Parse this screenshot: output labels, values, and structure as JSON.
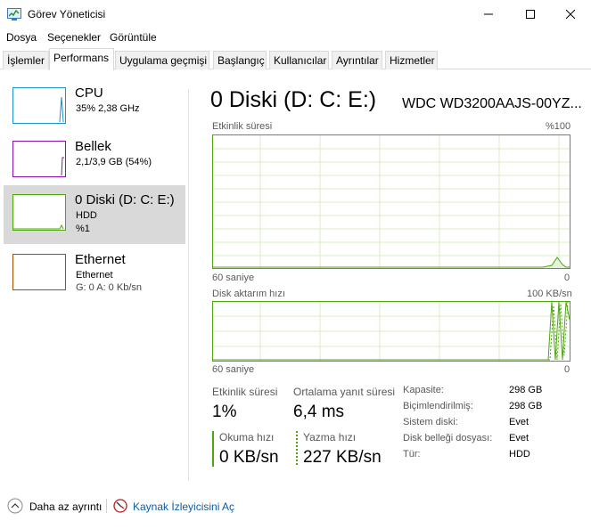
{
  "window": {
    "title": "Görev Yöneticisi"
  },
  "menu": [
    "Dosya",
    "Seçenekler",
    "Görüntüle"
  ],
  "tabs": [
    "İşlemler",
    "Performans",
    "Uygulama geçmişi",
    "Başlangıç",
    "Kullanıcılar",
    "Ayrıntılar",
    "Hizmetler"
  ],
  "sidebar": {
    "items": [
      {
        "name": "CPU",
        "sub1": "35% 2,38 GHz",
        "sub2": "",
        "color": "#1e8fc8"
      },
      {
        "name": "Bellek",
        "sub1": "2,1/3,9 GB (54%)",
        "sub2": "",
        "color": "#8b12ae"
      },
      {
        "name": "0 Diski (D: C: E:)",
        "sub1": "HDD",
        "sub2": "%1",
        "color": "#4da60c"
      },
      {
        "name": "Ethernet",
        "sub1": "Ethernet",
        "sub2": "G: 0 A: 0 Kb/sn",
        "color": "#a74f01"
      }
    ]
  },
  "main": {
    "title": "0 Diski (D: C: E:)",
    "model": "WDC WD3200AAJS-00YZ...",
    "activity_graph": {
      "label": "Etkinlik süresi",
      "max_label": "%100",
      "time_label": "60 saniye",
      "min_label": "0"
    },
    "transfer_graph": {
      "label": "Disk aktarım hızı",
      "max_label": "100 KB/sn",
      "time_label": "60 saniye",
      "min_label": "0"
    },
    "stats": {
      "activity_label": "Etkinlik süresi",
      "activity_value": "1%",
      "response_label": "Ortalama yanıt süresi",
      "response_value": "6,4 ms",
      "read_label": "Okuma hızı",
      "read_value": "0 KB/sn",
      "write_label": "Yazma hızı",
      "write_value": "227 KB/sn"
    },
    "properties": [
      {
        "label": "Kapasite:",
        "value": "298 GB"
      },
      {
        "label": "Biçimlendirilmiş:",
        "value": "298 GB"
      },
      {
        "label": "Sistem diski:",
        "value": "Evet"
      },
      {
        "label": "Disk belleği dosyası:",
        "value": "Evet"
      },
      {
        "label": "Tür:",
        "value": "HDD"
      }
    ]
  },
  "footer": {
    "fewer_details": "Daha az ayrıntı",
    "open_monitor": "Kaynak İzleyicisini Aç"
  },
  "colors": {
    "disk": "#4da60c",
    "cpu": "#1e8fc8",
    "memory": "#8b12ae",
    "ethernet": "#a74f01",
    "link": "#0b5ba8"
  }
}
